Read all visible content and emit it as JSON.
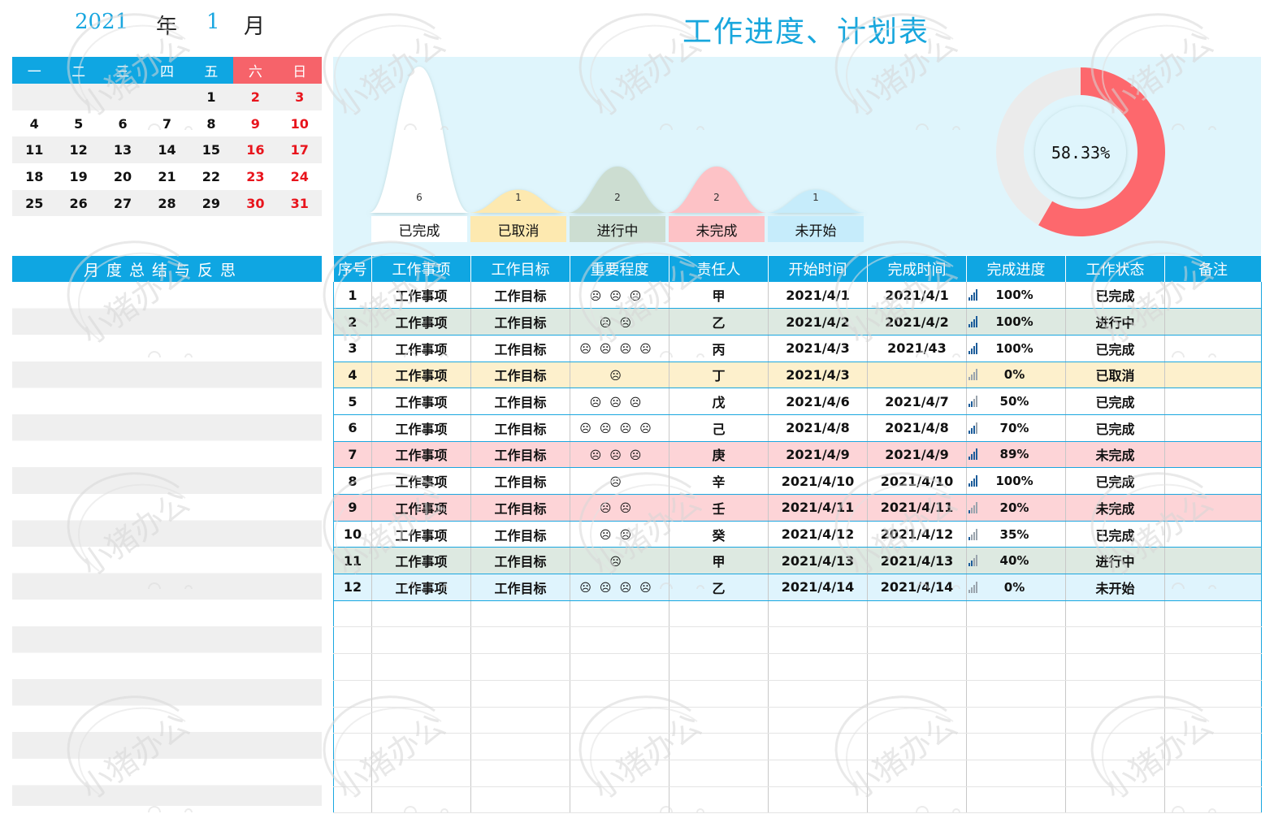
{
  "header": {
    "year": "2021",
    "year_label": "年",
    "month": "1",
    "month_label": "月"
  },
  "title": "工作进度、计划表",
  "calendar": {
    "weekdays": [
      "一",
      "二",
      "三",
      "四",
      "五",
      "六",
      "日"
    ],
    "weeks": [
      [
        "",
        "",
        "",
        "",
        "1",
        "2",
        "3"
      ],
      [
        "4",
        "5",
        "6",
        "7",
        "8",
        "9",
        "10"
      ],
      [
        "11",
        "12",
        "13",
        "14",
        "15",
        "16",
        "17"
      ],
      [
        "18",
        "19",
        "20",
        "21",
        "22",
        "23",
        "24"
      ],
      [
        "25",
        "26",
        "27",
        "28",
        "29",
        "30",
        "31"
      ],
      [
        "",
        "",
        "",
        "",
        "",
        "",
        ""
      ]
    ]
  },
  "summary": {
    "title": "月度总结与反思"
  },
  "chart_data": [
    {
      "type": "area",
      "categories": [
        "已完成",
        "已取消",
        "进行中",
        "未完成",
        "未开始"
      ],
      "values": [
        6,
        1,
        2,
        2,
        1
      ],
      "colors": [
        "#ffffff",
        "#fde9b0",
        "#ccddd1",
        "#fdc2c6",
        "#c6ecfb"
      ]
    },
    {
      "type": "pie",
      "values": [
        58.33,
        41.67
      ],
      "center_label": "58.33%",
      "colors": [
        "#fd686d",
        "#ebebeb"
      ]
    }
  ],
  "table": {
    "headers": [
      "序号",
      "工作事项",
      "工作目标",
      "重要程度",
      "责任人",
      "开始时间",
      "完成时间",
      "完成进度",
      "工作状态",
      "备注"
    ],
    "rows": [
      {
        "no": "1",
        "item": "工作事项",
        "goal": "工作目标",
        "imp": "☹☹☹",
        "owner": "甲",
        "start": "2021/4/1",
        "end": "2021/4/1",
        "progress": "100%",
        "pv": 1.0,
        "status": "已完成",
        "note": "",
        "cls": "st-done"
      },
      {
        "no": "2",
        "item": "工作事项",
        "goal": "工作目标",
        "imp": "☹☹",
        "owner": "乙",
        "start": "2021/4/2",
        "end": "2021/4/2",
        "progress": "100%",
        "pv": 1.0,
        "status": "进行中",
        "note": "",
        "cls": "st-doing"
      },
      {
        "no": "3",
        "item": "工作事项",
        "goal": "工作目标",
        "imp": "☹☹☹☹",
        "owner": "丙",
        "start": "2021/4/3",
        "end": "2021/43",
        "progress": "100%",
        "pv": 1.0,
        "status": "已完成",
        "note": "",
        "cls": "st-done"
      },
      {
        "no": "4",
        "item": "工作事项",
        "goal": "工作目标",
        "imp": "☹",
        "owner": "丁",
        "start": "2021/4/3",
        "end": "",
        "progress": "0%",
        "pv": 0.0,
        "status": "已取消",
        "note": "",
        "cls": "st-cancel"
      },
      {
        "no": "5",
        "item": "工作事项",
        "goal": "工作目标",
        "imp": "☹☹☹",
        "owner": "戊",
        "start": "2021/4/6",
        "end": "2021/4/7",
        "progress": "50%",
        "pv": 0.5,
        "status": "已完成",
        "note": "",
        "cls": "st-done"
      },
      {
        "no": "6",
        "item": "工作事项",
        "goal": "工作目标",
        "imp": "☹☹☹☹",
        "owner": "己",
        "start": "2021/4/8",
        "end": "2021/4/8",
        "progress": "70%",
        "pv": 0.7,
        "status": "已完成",
        "note": "",
        "cls": "st-done"
      },
      {
        "no": "7",
        "item": "工作事项",
        "goal": "工作目标",
        "imp": "☹☹☹",
        "owner": "庚",
        "start": "2021/4/9",
        "end": "2021/4/9",
        "progress": "89%",
        "pv": 0.89,
        "status": "未完成",
        "note": "",
        "cls": "st-undone"
      },
      {
        "no": "8",
        "item": "工作事项",
        "goal": "工作目标",
        "imp": "☹",
        "owner": "辛",
        "start": "2021/4/10",
        "end": "2021/4/10",
        "progress": "100%",
        "pv": 1.0,
        "status": "已完成",
        "note": "",
        "cls": "st-done"
      },
      {
        "no": "9",
        "item": "工作事项",
        "goal": "工作目标",
        "imp": "☹☹",
        "owner": "壬",
        "start": "2021/4/11",
        "end": "2021/4/11",
        "progress": "20%",
        "pv": 0.2,
        "status": "未完成",
        "note": "",
        "cls": "st-undone"
      },
      {
        "no": "10",
        "item": "工作事项",
        "goal": "工作目标",
        "imp": "☹☹",
        "owner": "癸",
        "start": "2021/4/12",
        "end": "2021/4/12",
        "progress": "35%",
        "pv": 0.35,
        "status": "已完成",
        "note": "",
        "cls": "st-done"
      },
      {
        "no": "11",
        "item": "工作事项",
        "goal": "工作目标",
        "imp": "☹",
        "owner": "甲",
        "start": "2021/4/13",
        "end": "2021/4/13",
        "progress": "40%",
        "pv": 0.4,
        "status": "进行中",
        "note": "",
        "cls": "st-doing"
      },
      {
        "no": "12",
        "item": "工作事项",
        "goal": "工作目标",
        "imp": "☹☹☹☹",
        "owner": "乙",
        "start": "2021/4/14",
        "end": "2021/4/14",
        "progress": "0%",
        "pv": 0.0,
        "status": "未开始",
        "note": "",
        "cls": "st-notstart"
      }
    ],
    "empty_rows": 8
  },
  "watermark": {
    "text": "小猪办公"
  }
}
